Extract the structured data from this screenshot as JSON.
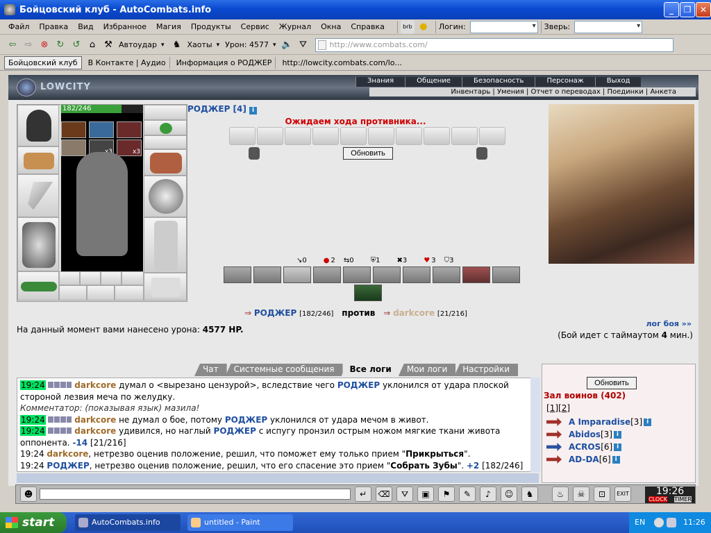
{
  "window": {
    "title": "Бойцовский клуб - AutoCombats.info"
  },
  "menu": [
    "Файл",
    "Правка",
    "Вид",
    "Избранное",
    "Магия",
    "Продукты",
    "Сервис",
    "Журнал",
    "Окна",
    "Справка"
  ],
  "login_label": "Логин:",
  "zver_label": "Зверь:",
  "toolbar": {
    "autoudar": "Автоудар",
    "haoty": "Хаоты",
    "uron": "Урон: 4577",
    "address": "http://www.combats.com/"
  },
  "bookmarks": [
    "Бойцовский клуб",
    "В Контакте | Аудио",
    "Информация о РОДЖЕР",
    "http://lowcity.combats.com/lo..."
  ],
  "site": {
    "logo": "LOWCITY",
    "nav_top": [
      "Знания",
      "Общение",
      "Безопасность",
      "Персонаж",
      "Выход"
    ],
    "nav_sub": "Инвентарь | Умения | Отчет о переводах | Поединки | Анкета"
  },
  "player": {
    "name": "РОДЖЕР [4]",
    "hp_text": "182/246",
    "hp_fraction": 0.74,
    "x3a": "x3",
    "x3b": "x3"
  },
  "battle": {
    "waiting": "Ожидаем хода противника...",
    "refresh": "Обновить",
    "stats": [
      "0",
      "2",
      "0",
      "1",
      "3",
      "3",
      "3"
    ],
    "p1": "РОДЖЕР",
    "p1hp": "[182/246]",
    "versus": "против",
    "p2": "darkcore",
    "p2hp": "[21/216]",
    "damage_prefix": "На данный момент вами нанесено урона:",
    "damage_value": "4577 HP.",
    "log_link": "лог боя »»",
    "timeout_prefix": "(Бой идет с таймаутом",
    "timeout_value": "4",
    "timeout_suffix": "мин.)"
  },
  "chat": {
    "tabs": [
      "Чат",
      "Системные сообщения",
      "Все логи",
      "Мои логи",
      "Настройки"
    ],
    "time": "19:24",
    "l1a": "darkcore",
    "l1b": "думал о <вырезано цензурой>, вследствие чего",
    "l1c": "РОДЖЕР",
    "l1d": "уклонился от удара плоской стороной лезвия меча по желудку.",
    "l2": "Комментатор: (показывая язык) мазила!",
    "l3a": "darkcore",
    "l3b": "не думал о бое, потому",
    "l3c": "РОДЖЕР",
    "l3d": "уклонился от удара мечом в живот.",
    "l4a": "darkcore",
    "l4b": "удивился, но наглый",
    "l4c": "РОДЖЕР",
    "l4d": "с испугу пронзил острым ножом мягкие ткани живота оппонента.",
    "l4e": "-14",
    "l4f": "[21/216]",
    "l5a": "darkcore",
    "l5b": ", нетрезво оценив положение, решил, что поможет ему только прием \"",
    "l5c": "Прикрыться",
    "l5d": "\".",
    "l6a": "РОДЖЕР",
    "l6b": ", нетрезво оценив положение, решил, что его спасение это прием \"",
    "l6c": "Собрать Зубы",
    "l6d": "\".",
    "l6e": "+2",
    "l6f": "[182/246]"
  },
  "room": {
    "refresh": "Обновить",
    "title": "Зал воинов (402)",
    "page1": "1",
    "page2": "2",
    "players": [
      {
        "name": "A Imparadise",
        "level": "[3]"
      },
      {
        "name": "Abidos",
        "level": "[3]"
      },
      {
        "name": "ACROS",
        "level": "[6]"
      },
      {
        "name": "AD-DA",
        "level": "[6]"
      }
    ]
  },
  "clock": {
    "time": "19:26",
    "label1": "CLOCK",
    "label2": "TIMER"
  },
  "taskbar": {
    "start": "start",
    "task1": "AutoCombats.info",
    "task2": "untitled - Paint",
    "lang": "EN",
    "time": "11:26"
  }
}
